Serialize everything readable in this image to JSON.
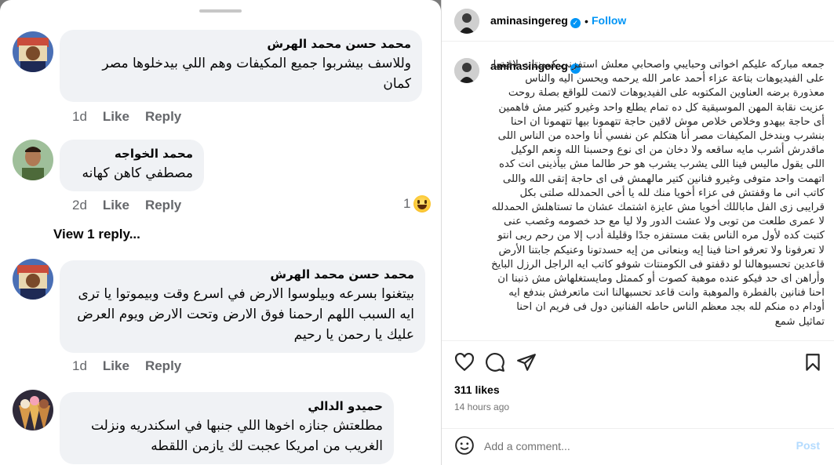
{
  "comments": [
    {
      "name": "محمد حسن محمد الهرش",
      "text": "وللاسف بيشربوا جميع المكيفات وهم اللي بيدخلوها مصر كمان",
      "age": "1d",
      "like_label": "Like",
      "reply_label": "Reply"
    },
    {
      "name": "محمد الخواجه",
      "text": "مصطفي كاهن كهانه",
      "age": "2d",
      "like_label": "Like",
      "reply_label": "Reply",
      "reaction_count": "1",
      "reaction_icon": "haha-emoji"
    },
    {
      "name": "محمد حسن محمد الهرش",
      "text": "بيتغنوا بسرعه وبيلوسوا الارض في اسرع وقت وبيموتوا يا ترى ايه السبب اللهم ارحمنا فوق الارض وتحت الارض ويوم العرض عليك يا رحمن يا رحيم",
      "age": "1d",
      "like_label": "Like",
      "reply_label": "Reply"
    },
    {
      "name": "حميدو الدالي",
      "text": "مطلعتش جنازه اخوها اللي جنبها في اسكندريه ونزلت الغريب من امريكا عجبت لك يازمن اللقطه"
    }
  ],
  "view_replies_label": "View 1 reply...",
  "post": {
    "username": "aminasingereg",
    "follow_label": "Follow",
    "separator": "•",
    "caption": "جمعه مباركه عليكم اخواتى وحبايبي واصحابي معلش استفزنى كومنتات لاقيتها على الفيديوهات بتاعة عزاء أحمد عامر الله يرحمه ويحسن اليه والناس معذورة برضه العناوين المكتوبه على الفيديوهات لاتمت للواقع بصلة روحت عزيت نقابة المهن الموسيقية كل ده تمام يطلع واحد وغيرو كتير مش فاهمين أى حاجة بيهدو وخلاص خلاص موش لاقين حاجة تتهمونا بيها تتهمونا ان احنا بنشرب وبندخل المكيفات مصر أنا هتكلم عن نفسي أنا واحده من الناس اللى ماقدرش أشرب مايه ساقعه ولا دخان من اى نوع وحسبنا الله ونعم الوكيل اللى يقول ماليس فينا اللى يشرب يشرب هو حر طالما مش بيأذينى انت كده اتهمت واحد متوفى وغيرو فنانين كتير مالهمش فى اى حاجة إتقى الله واللى كاتب انى ما وقفتش فى عزاء أخويا منك لله يا أخى الحمدلله صلتى بكل قرايبى زى الفل ماباللك أخويا مش عايزة اشتمك عشان ما تستاهلش الحمدلله لا عمرى طلعت من توبى ولا عشت الدور ولا ليا مع حد خصومه وغصب عنى كتبت كده لأول مره الناس بقت مستفزه جدًا وقليلة أدب إلا من رحم ربى انتو لا تعرفونا ولا تعرفو احنا فينا إيه وبنعانى من إيه حسدتونا وعنيكم جابتنا الأرض قاعدين تحسبوهالنا لو دقفتو فى الكومنتات شوفو كاتب ايه الراجل الرزل البايخ وأراهن اى حد فيكو عنده موهبة كصوت أو كممثل ومايستغلهاش مش ذنبنا ان احنا فنانين بالفطرة والموهبة وانت قاعد تحسبهالنا انت ماتعرفش بندفع ايه أودام ده منكم لله بجد معظم الناس حاطه الفنانين دول فى فريم ان احنا تماثيل شمع",
    "likes": "311 likes",
    "time": "14 hours ago",
    "comment_placeholder": "Add a comment...",
    "post_label": "Post"
  },
  "colors": {
    "accent": "#0095f6",
    "bubble": "#f0f2f5",
    "muted": "#65676b",
    "post_disabled": "#b3dbff"
  }
}
